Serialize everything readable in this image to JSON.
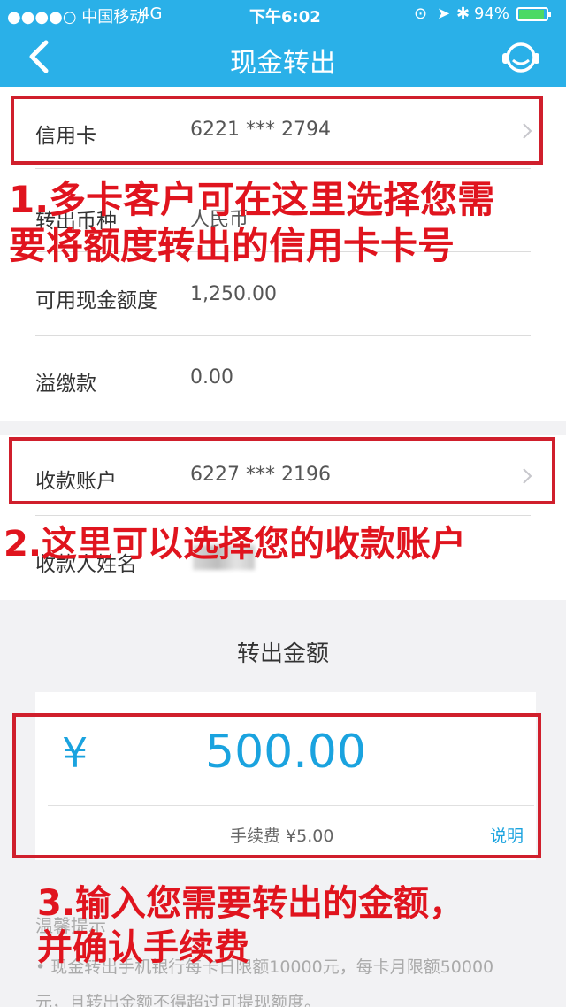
{
  "status_bar": {
    "carrier": "●●●●○ 中国移动",
    "network": "4G",
    "time": "下午6:02",
    "battery": "94%"
  },
  "nav": {
    "title": "现金转出"
  },
  "card_section": {
    "card_label": "信用卡",
    "card_number": "6221 *** 2794",
    "currency_label": "转出币种",
    "currency_value": "人民币",
    "cash_limit_label": "可用现金额度",
    "cash_limit_value": "1,250.00",
    "overpay_label": "溢缴款",
    "overpay_value": "0.00"
  },
  "account_section": {
    "account_label": "收款账户",
    "account_number": "6227 *** 2196",
    "payee_label": "收款人姓名"
  },
  "amount_section": {
    "title": "转出金额",
    "currency_symbol": "¥",
    "amount": "500.00",
    "fee": "手续费 ¥5.00",
    "explain_link": "说明"
  },
  "tips": {
    "title": "温馨提示",
    "line1": "• 现金转出手机银行每卡日限额10000元，每卡月限额50000",
    "line2": "元，且转出金额不得超过可提现额度。"
  },
  "annotations": {
    "a1_line1": "1.多卡客户可在这里选择您需",
    "a1_line2": "要将额度转出的信用卡卡号",
    "a2": "2.这里可以选择您的收款账户",
    "a3_line1": "3.输入您需要转出的金额，",
    "a3_line2": "并确认手续费"
  },
  "colors": {
    "header": "#2ab0e8",
    "accent": "#1aa3df",
    "annotation_red": "#e0141e"
  }
}
